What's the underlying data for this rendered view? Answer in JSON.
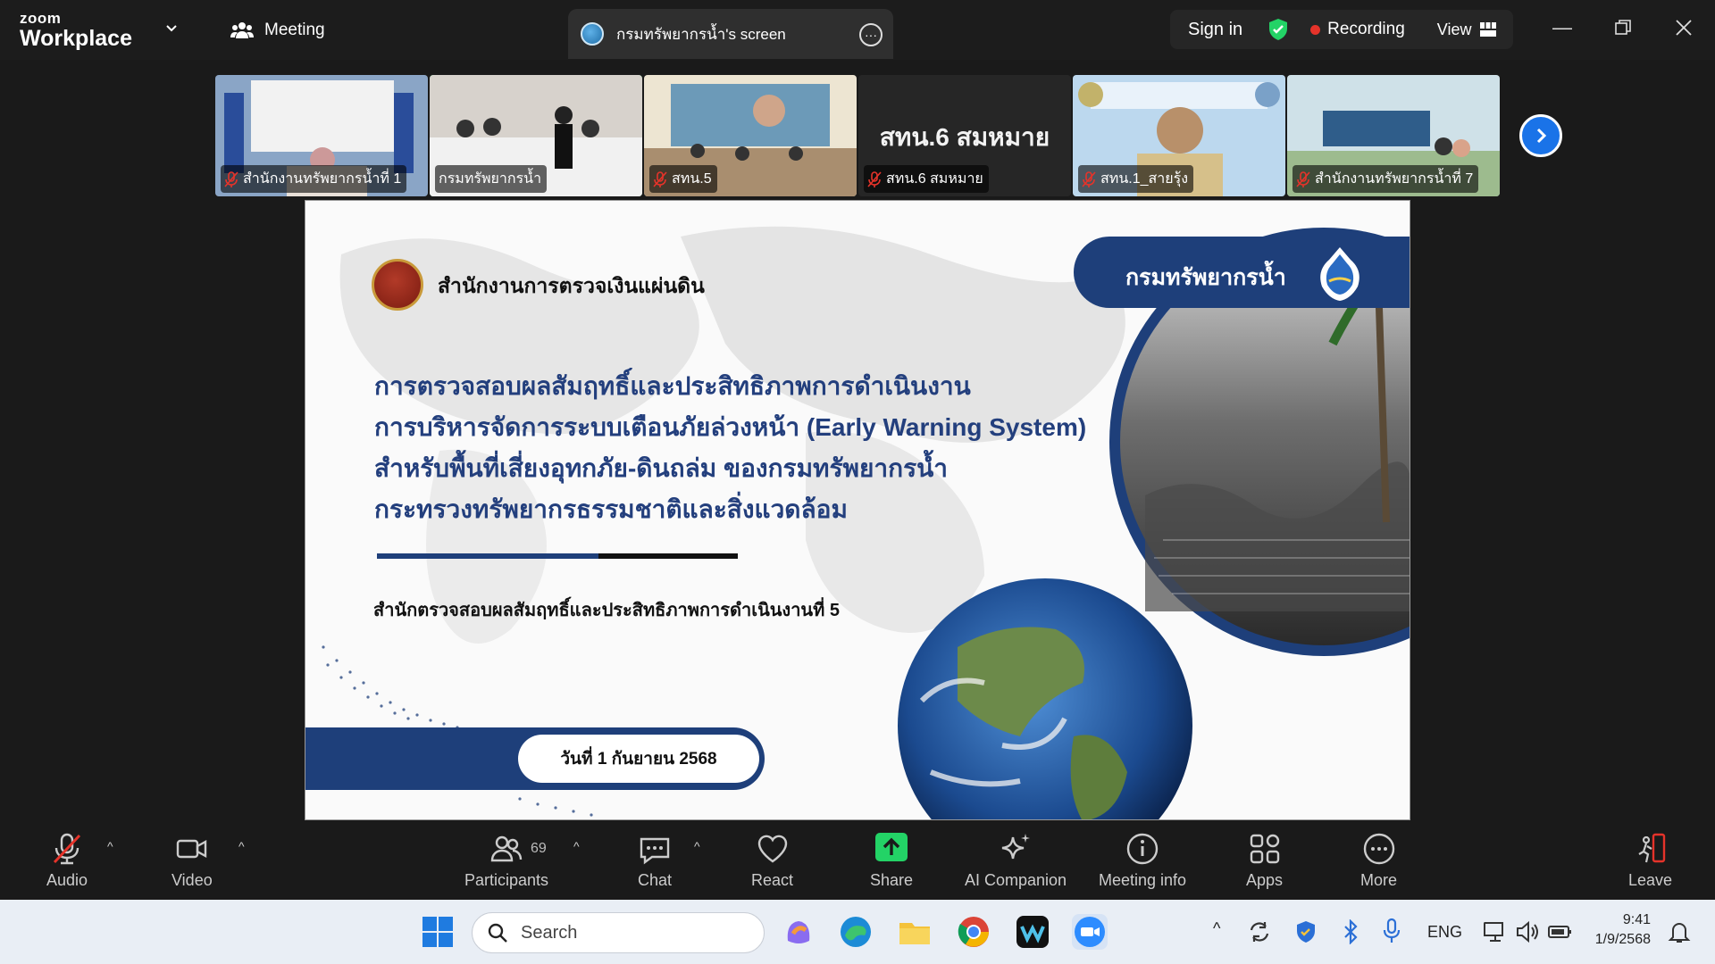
{
  "app": {
    "brand_small": "zoom",
    "brand_large": "Workplace",
    "meeting_label": "Meeting",
    "screen_tab_label": "กรมทรัพยากรน้ำ's screen",
    "signin_label": "Sign in",
    "recording_label": "Recording",
    "view_label": "View"
  },
  "thumbnails": [
    {
      "name": "สำนักงานทรัพยากรน้ำที่ 1",
      "muted": true,
      "active": false
    },
    {
      "name": "กรมทรัพยากรน้ำ",
      "muted": false,
      "active": true
    },
    {
      "name": "สทน.5",
      "muted": true,
      "active": false
    },
    {
      "name": "สทน.6 สมหมาย",
      "muted": true,
      "active": false,
      "big_name": "สทน.6 สมหมาย"
    },
    {
      "name": "สทน.1_สายรุ้ง",
      "muted": true,
      "active": false
    },
    {
      "name": "สำนักงานทรัพยากรน้ำที่ 7",
      "muted": true,
      "active": false
    }
  ],
  "slide": {
    "org_name": "สำนักงานการตรวจเงินแผ่นดิน",
    "dept_name": "กรมทรัพยากรน้ำ",
    "title_lines": [
      "การตรวจสอบผลสัมฤทธิ์และประสิทธิภาพการดำเนินงาน",
      "การบริหารจัดการระบบเตือนภัยล่วงหน้า (Early Warning System)",
      "สำหรับพื้นที่เสี่ยงอุทกภัย-ดินถล่ม ของกรมทรัพยากรน้ำ",
      "กระทรวงทรัพยากรธรรมชาติและสิ่งแวดล้อม"
    ],
    "subtitle": "สำนักตรวจสอบผลสัมฤทธิ์และประสิทธิภาพการดำเนินงานที่ 5",
    "date": "วันที่ 1 กันยายน 2568"
  },
  "controls": {
    "audio": "Audio",
    "video": "Video",
    "participants": "Participants",
    "participant_count": "69",
    "chat": "Chat",
    "react": "React",
    "share": "Share",
    "ai_companion": "AI Companion",
    "meeting_info": "Meeting info",
    "apps": "Apps",
    "more": "More",
    "leave": "Leave"
  },
  "taskbar": {
    "search_placeholder": "Search",
    "language": "ENG",
    "time": "9:41",
    "date": "1/9/2568"
  },
  "colors": {
    "accent_green": "#23d366",
    "zoom_blue": "#1a73e8",
    "slide_navy": "#1e3f7a",
    "recording_red": "#e5332a"
  }
}
